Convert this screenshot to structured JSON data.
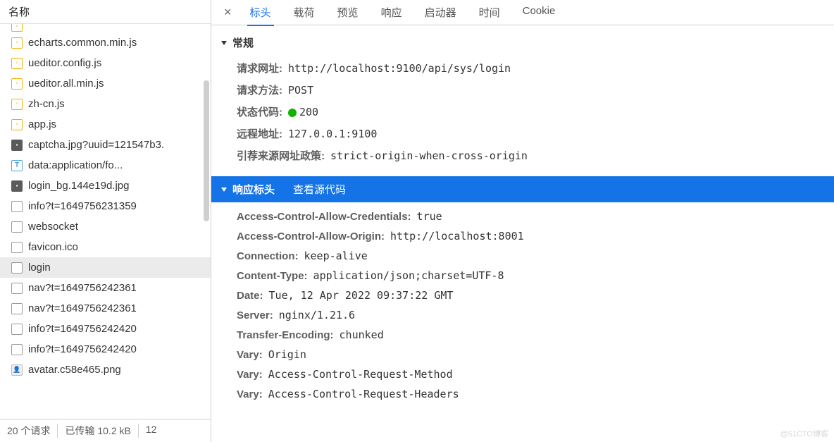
{
  "sidebar": {
    "header": "名称",
    "files": [
      {
        "icon": "js",
        "name": ""
      },
      {
        "icon": "js",
        "name": "echarts.common.min.js"
      },
      {
        "icon": "js",
        "name": "ueditor.config.js"
      },
      {
        "icon": "js",
        "name": "ueditor.all.min.js"
      },
      {
        "icon": "js",
        "name": "zh-cn.js"
      },
      {
        "icon": "js",
        "name": "app.js"
      },
      {
        "icon": "img",
        "name": "captcha.jpg?uuid=121547b3."
      },
      {
        "icon": "txt",
        "name": "data:application/fo..."
      },
      {
        "icon": "img",
        "name": "login_bg.144e19d.jpg"
      },
      {
        "icon": "doc",
        "name": "info?t=1649756231359"
      },
      {
        "icon": "doc",
        "name": "websocket"
      },
      {
        "icon": "doc",
        "name": "favicon.ico"
      },
      {
        "icon": "doc",
        "name": "login",
        "selected": true
      },
      {
        "icon": "doc",
        "name": "nav?t=1649756242361"
      },
      {
        "icon": "doc",
        "name": "nav?t=1649756242361"
      },
      {
        "icon": "doc",
        "name": "info?t=1649756242420"
      },
      {
        "icon": "doc",
        "name": "info?t=1649756242420"
      },
      {
        "icon": "av",
        "name": "avatar.c58e465.png"
      }
    ],
    "footer": {
      "requests": "20 个请求",
      "transferred": "已传输 10.2 kB",
      "extra": "12"
    }
  },
  "tabs": {
    "close": "×",
    "items": [
      {
        "label": "标头",
        "active": true
      },
      {
        "label": "载荷"
      },
      {
        "label": "预览"
      },
      {
        "label": "响应"
      },
      {
        "label": "启动器"
      },
      {
        "label": "时间"
      },
      {
        "label": "Cookie"
      }
    ]
  },
  "sections": {
    "general": {
      "title": "常规",
      "rows": [
        {
          "key": "请求网址:",
          "val": "http://localhost:9100/api/sys/login"
        },
        {
          "key": "请求方法:",
          "val": "POST"
        },
        {
          "key": "状态代码:",
          "val": "200",
          "status": true
        },
        {
          "key": "远程地址:",
          "val": "127.0.0.1:9100"
        },
        {
          "key": "引荐来源网址政策:",
          "val": "strict-origin-when-cross-origin"
        }
      ]
    },
    "response_headers": {
      "title": "响应标头",
      "view_source": "查看源代码",
      "rows": [
        {
          "key": "Access-Control-Allow-Credentials:",
          "val": "true"
        },
        {
          "key": "Access-Control-Allow-Origin:",
          "val": "http://localhost:8001"
        },
        {
          "key": "Connection:",
          "val": "keep-alive"
        },
        {
          "key": "Content-Type:",
          "val": "application/json;charset=UTF-8"
        },
        {
          "key": "Date:",
          "val": "Tue, 12 Apr 2022 09:37:22 GMT"
        },
        {
          "key": "Server:",
          "val": "nginx/1.21.6"
        },
        {
          "key": "Transfer-Encoding:",
          "val": "chunked"
        },
        {
          "key": "Vary:",
          "val": "Origin"
        },
        {
          "key": "Vary:",
          "val": "Access-Control-Request-Method"
        },
        {
          "key": "Vary:",
          "val": "Access-Control-Request-Headers"
        }
      ]
    }
  },
  "watermark": "@51CTO博客"
}
